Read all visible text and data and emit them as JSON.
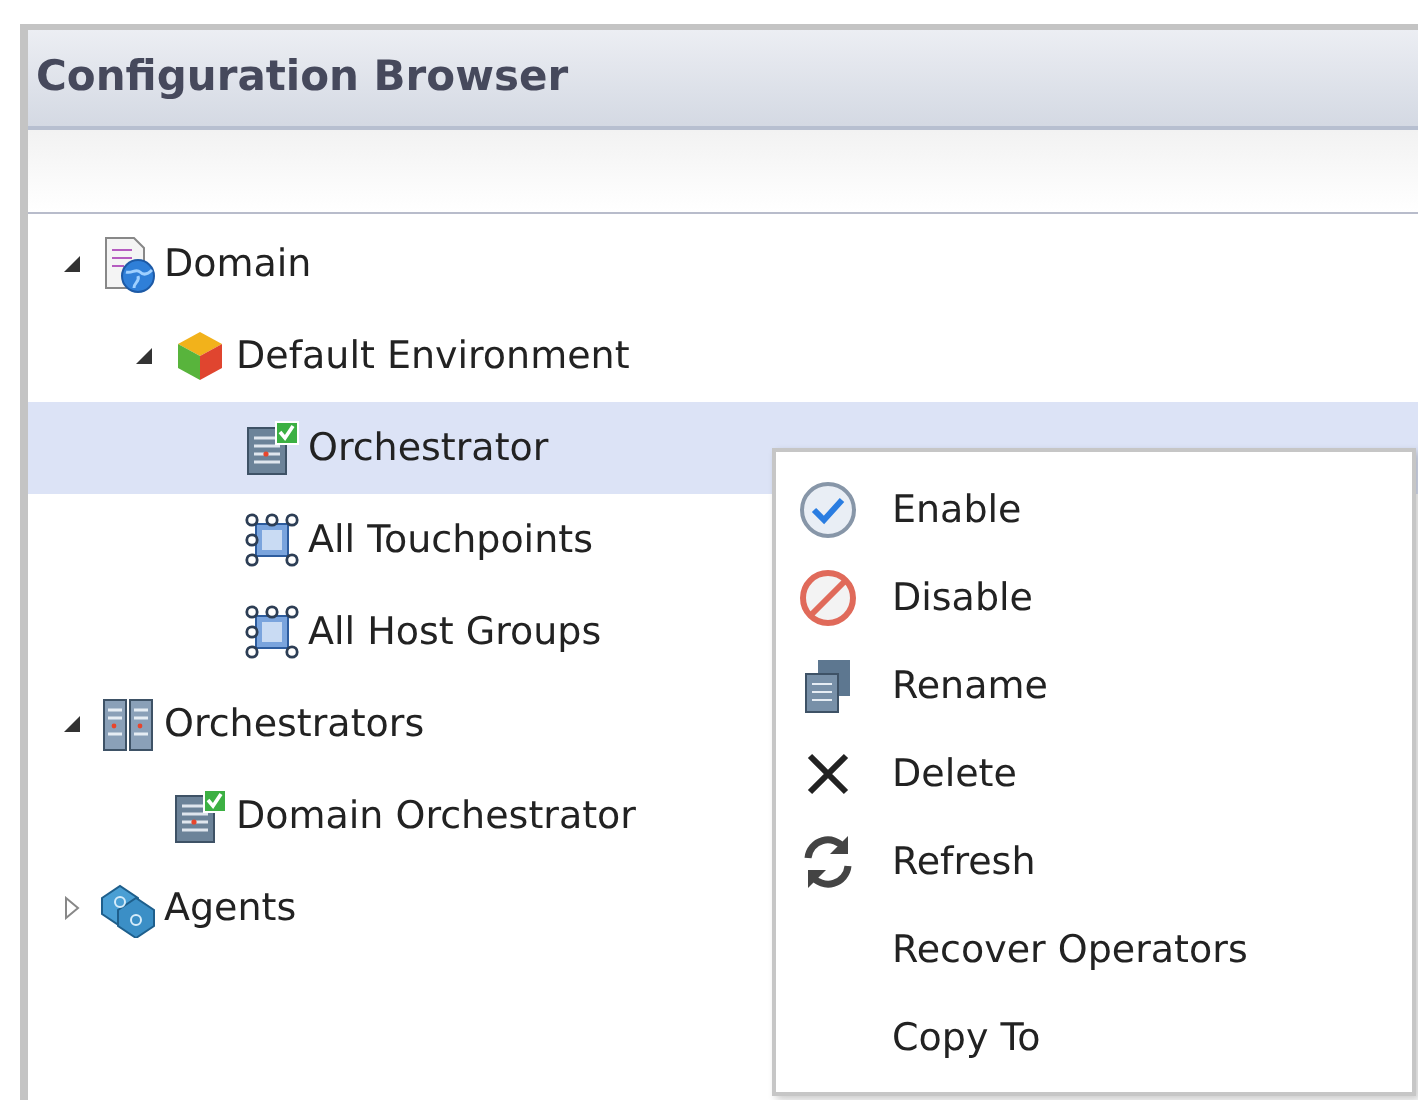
{
  "panel": {
    "title": "Configuration Browser"
  },
  "tree": [
    {
      "label": "Domain",
      "kind": "domain",
      "expanded": true,
      "selected": false,
      "children": [
        {
          "label": "Default Environment",
          "kind": "environment",
          "expanded": true,
          "selected": false,
          "children": [
            {
              "label": "Orchestrator",
              "kind": "orchestrator",
              "selected": true
            },
            {
              "label": "All Touchpoints",
              "kind": "group",
              "selected": false
            },
            {
              "label": "All Host Groups",
              "kind": "group",
              "selected": false
            }
          ]
        }
      ]
    },
    {
      "label": "Orchestrators",
      "kind": "servers",
      "expanded": true,
      "selected": false,
      "children": [
        {
          "label": "Domain Orchestrator",
          "kind": "orchestrator",
          "selected": false
        }
      ]
    },
    {
      "label": "Agents",
      "kind": "agents",
      "expanded": false,
      "selected": false
    }
  ],
  "context_menu": [
    {
      "label": "Enable",
      "kind": "enable"
    },
    {
      "label": "Disable",
      "kind": "disable"
    },
    {
      "label": "Rename",
      "kind": "rename"
    },
    {
      "label": "Delete",
      "kind": "delete"
    },
    {
      "label": "Refresh",
      "kind": "refresh"
    },
    {
      "label": "Recover Operators",
      "kind": "plain"
    },
    {
      "label": "Copy To",
      "kind": "plain"
    }
  ]
}
